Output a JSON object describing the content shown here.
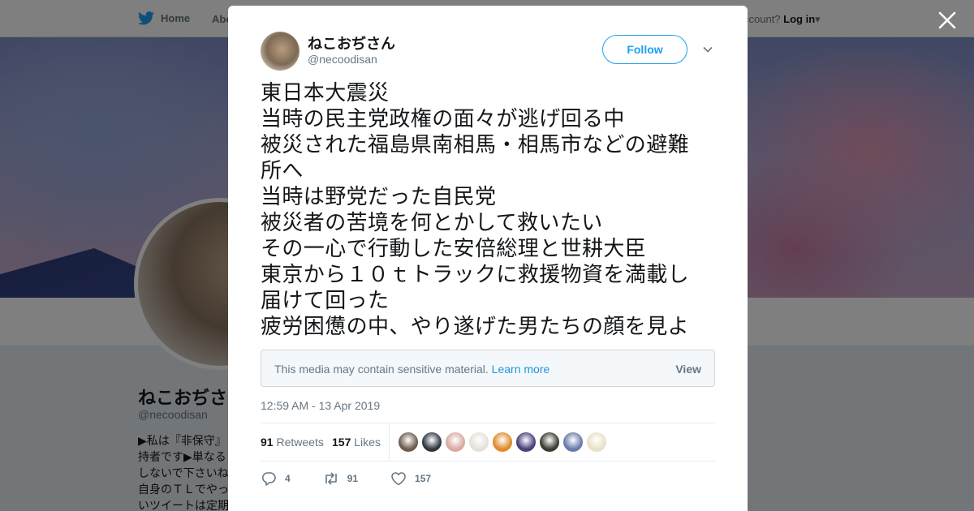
{
  "nav": {
    "home_label": "Home",
    "about_label": "Abo",
    "account_prompt": "ccount?",
    "login_label": "Log in"
  },
  "profile": {
    "name": "ねこおぢさ",
    "handle": "@necoodisan",
    "bio": "▶私は『非保守』持者です▶単なるしないで下さいね自身のＴＬでやっいツイートは定期"
  },
  "tweet": {
    "author_name": "ねこおぢさん",
    "author_handle": "@necoodisan",
    "follow_label": "Follow",
    "text_lines": [
      "東日本大震災",
      "当時の民主党政権の面々が逃げ回る中",
      "被災された福島県南相馬・相馬市などの避難",
      "所へ",
      "当時は野党だった自民党",
      "被災者の苦境を何とかして救いたい",
      "その一心で行動した安倍総理と世耕大臣",
      "東京から１０ｔトラックに救援物資を満載し",
      "届けて回った",
      "疲労困憊の中、やり遂げた男たちの顔を見よ"
    ],
    "sensitive_message": "This media may contain sensitive material.",
    "learn_more_label": "Learn more",
    "view_label": "View",
    "timestamp": "12:59 AM - 13 Apr 2019",
    "retweets_count": "91",
    "retweets_label": "Retweets",
    "likes_count": "157",
    "likes_label": "Likes",
    "liker_colors": [
      "#6e5b4c",
      "#2f3640",
      "#d9a9a0",
      "#e6e0d8",
      "#e08a2a",
      "#4a3f7a",
      "#3b3b30",
      "#6a7aa8",
      "#e8e0c8"
    ],
    "reply_count": "4",
    "retweet_action_count": "91",
    "like_action_count": "157"
  },
  "colors": {
    "accent": "#1da1f2",
    "link": "#1b95e0",
    "muted": "#657786"
  },
  "icons": [
    "twitter-bird-icon",
    "close-icon",
    "chevron-down-icon",
    "reply-icon",
    "retweet-icon",
    "heart-icon"
  ]
}
